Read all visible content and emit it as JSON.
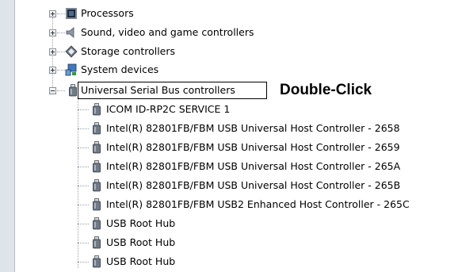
{
  "device_tree": {
    "categories": [
      {
        "label": "Processors",
        "icon": "processor-icon",
        "expanded": false
      },
      {
        "label": "Sound, video and game controllers",
        "icon": "speaker-icon",
        "expanded": false
      },
      {
        "label": "Storage controllers",
        "icon": "storage-controller-icon",
        "expanded": false
      },
      {
        "label": "System devices",
        "icon": "system-devices-icon",
        "expanded": false
      },
      {
        "label": "Universal Serial Bus controllers",
        "icon": "usb-plug-icon",
        "expanded": true
      }
    ],
    "usb_devices": [
      "ICOM ID-RP2C SERVICE 1",
      "Intel(R) 82801FB/FBM USB Universal Host Controller - 2658",
      "Intel(R) 82801FB/FBM USB Universal Host Controller - 2659",
      "Intel(R) 82801FB/FBM USB Universal Host Controller - 265A",
      "Intel(R) 82801FB/FBM USB Universal Host Controller - 265B",
      "Intel(R) 82801FB/FBM USB2 Enhanced Host Controller - 265C",
      "USB Root Hub",
      "USB Root Hub",
      "USB Root Hub"
    ]
  },
  "annotation": {
    "text": "Double-Click"
  }
}
